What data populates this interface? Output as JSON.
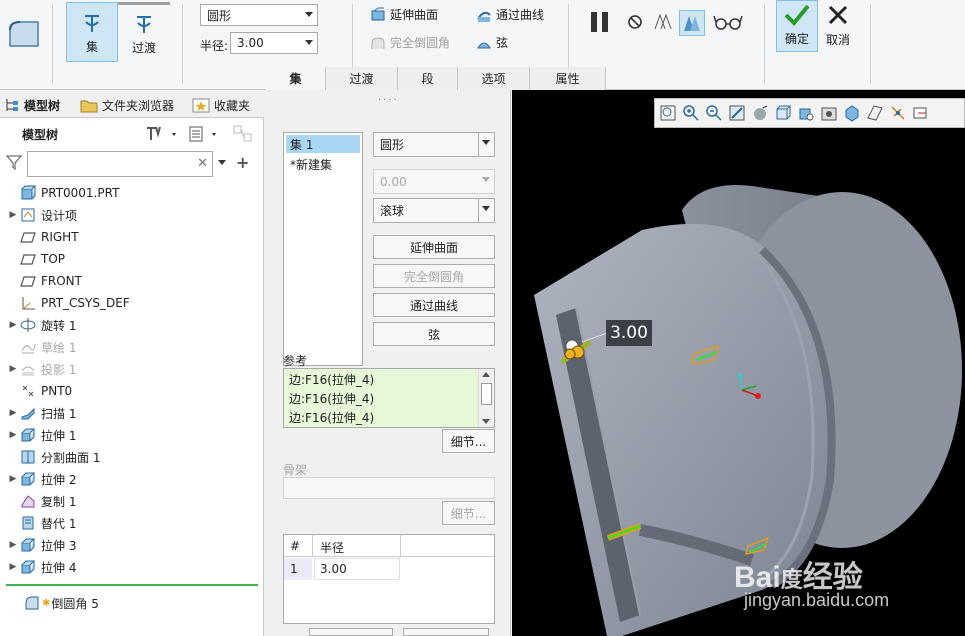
{
  "ribbon": {
    "set_label": "集",
    "transition_label": "过渡",
    "shape_value": "圆形",
    "radius_label": "半径:",
    "radius_value": "3.00",
    "extend_surfaces": "延伸曲面",
    "full_round": "完全倒圆角",
    "through_curve": "通过曲线",
    "chord": "弦",
    "ok_label": "确定",
    "cancel_label": "取消",
    "tabs": [
      "集",
      "过渡",
      "段",
      "选项",
      "属性"
    ]
  },
  "left_panel": {
    "tabs": [
      "模型树",
      "文件夹浏览器",
      "收藏夹"
    ],
    "title": "模型树",
    "search_placeholder": "",
    "items": [
      {
        "label": "PRT0001.PRT",
        "icon": "part-icon",
        "expand": ""
      },
      {
        "label": "设计项",
        "icon": "design-items-icon",
        "expand": "▶"
      },
      {
        "label": "RIGHT",
        "icon": "datum-plane-icon",
        "expand": ""
      },
      {
        "label": "TOP",
        "icon": "datum-plane-icon",
        "expand": ""
      },
      {
        "label": "FRONT",
        "icon": "datum-plane-icon",
        "expand": ""
      },
      {
        "label": "PRT_CSYS_DEF",
        "icon": "csys-icon",
        "expand": ""
      },
      {
        "label": "旋转 1",
        "icon": "revolve-icon",
        "expand": "▶"
      },
      {
        "label": "草绘 1",
        "icon": "sketch-icon",
        "expand": "",
        "dim": true
      },
      {
        "label": "投影 1",
        "icon": "project-icon",
        "expand": "▶",
        "dim": true
      },
      {
        "label": "PNT0",
        "icon": "datum-point-icon",
        "expand": ""
      },
      {
        "label": "扫描 1",
        "icon": "sweep-icon",
        "expand": "▶"
      },
      {
        "label": "拉伸 1",
        "icon": "extrude-icon",
        "expand": "▶"
      },
      {
        "label": "分割曲面 1",
        "icon": "split-surface-icon",
        "expand": ""
      },
      {
        "label": "拉伸 2",
        "icon": "extrude-icon",
        "expand": "▶"
      },
      {
        "label": "复制 1",
        "icon": "copy-icon",
        "expand": ""
      },
      {
        "label": "替代 1",
        "icon": "replace-icon",
        "expand": ""
      },
      {
        "label": "拉伸 3",
        "icon": "extrude-icon",
        "expand": "▶"
      },
      {
        "label": "拉伸 4",
        "icon": "extrude-icon",
        "expand": "▶"
      }
    ],
    "insert_item": "倒圆角 5"
  },
  "sets_panel": {
    "sets": [
      "集 1",
      "*新建集"
    ],
    "shape": "圆形",
    "value": "0.00",
    "method": "滚球",
    "extend_surfaces": "延伸曲面",
    "full_round": "完全倒圆角",
    "through_curve": "通过曲线",
    "chord": "弦",
    "refs_label": "参考",
    "refs": [
      "边:F16(拉伸_4)",
      "边:F16(拉伸_4)",
      "边:F16(拉伸_4)"
    ],
    "details": "细节...",
    "skeleton_label": "骨架",
    "skeleton_details": "细节...",
    "table_headers": [
      "#",
      "半径"
    ],
    "table_rows": [
      [
        "1",
        "3.00"
      ]
    ]
  },
  "viewport": {
    "dimension": "3.00"
  },
  "colors": {
    "accent": "#cfe6f7",
    "selection": "#aad6f5",
    "ok_green": "#2a9b2a",
    "refs_bg": "#e6f8d8"
  }
}
